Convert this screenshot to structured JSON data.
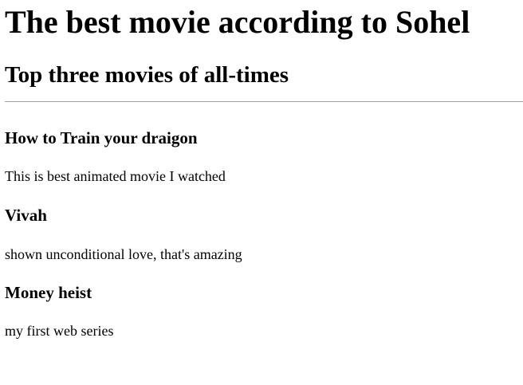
{
  "page": {
    "title": "The best movie according to Sohel",
    "subtitle": "Top three movies of all-times"
  },
  "movies": [
    {
      "title": "How to Train your draigon",
      "description": "This is best animated movie I watched"
    },
    {
      "title": "Vivah",
      "description": "shown unconditional love, that's amazing"
    },
    {
      "title": "Money heist",
      "description": "my first web series"
    }
  ]
}
